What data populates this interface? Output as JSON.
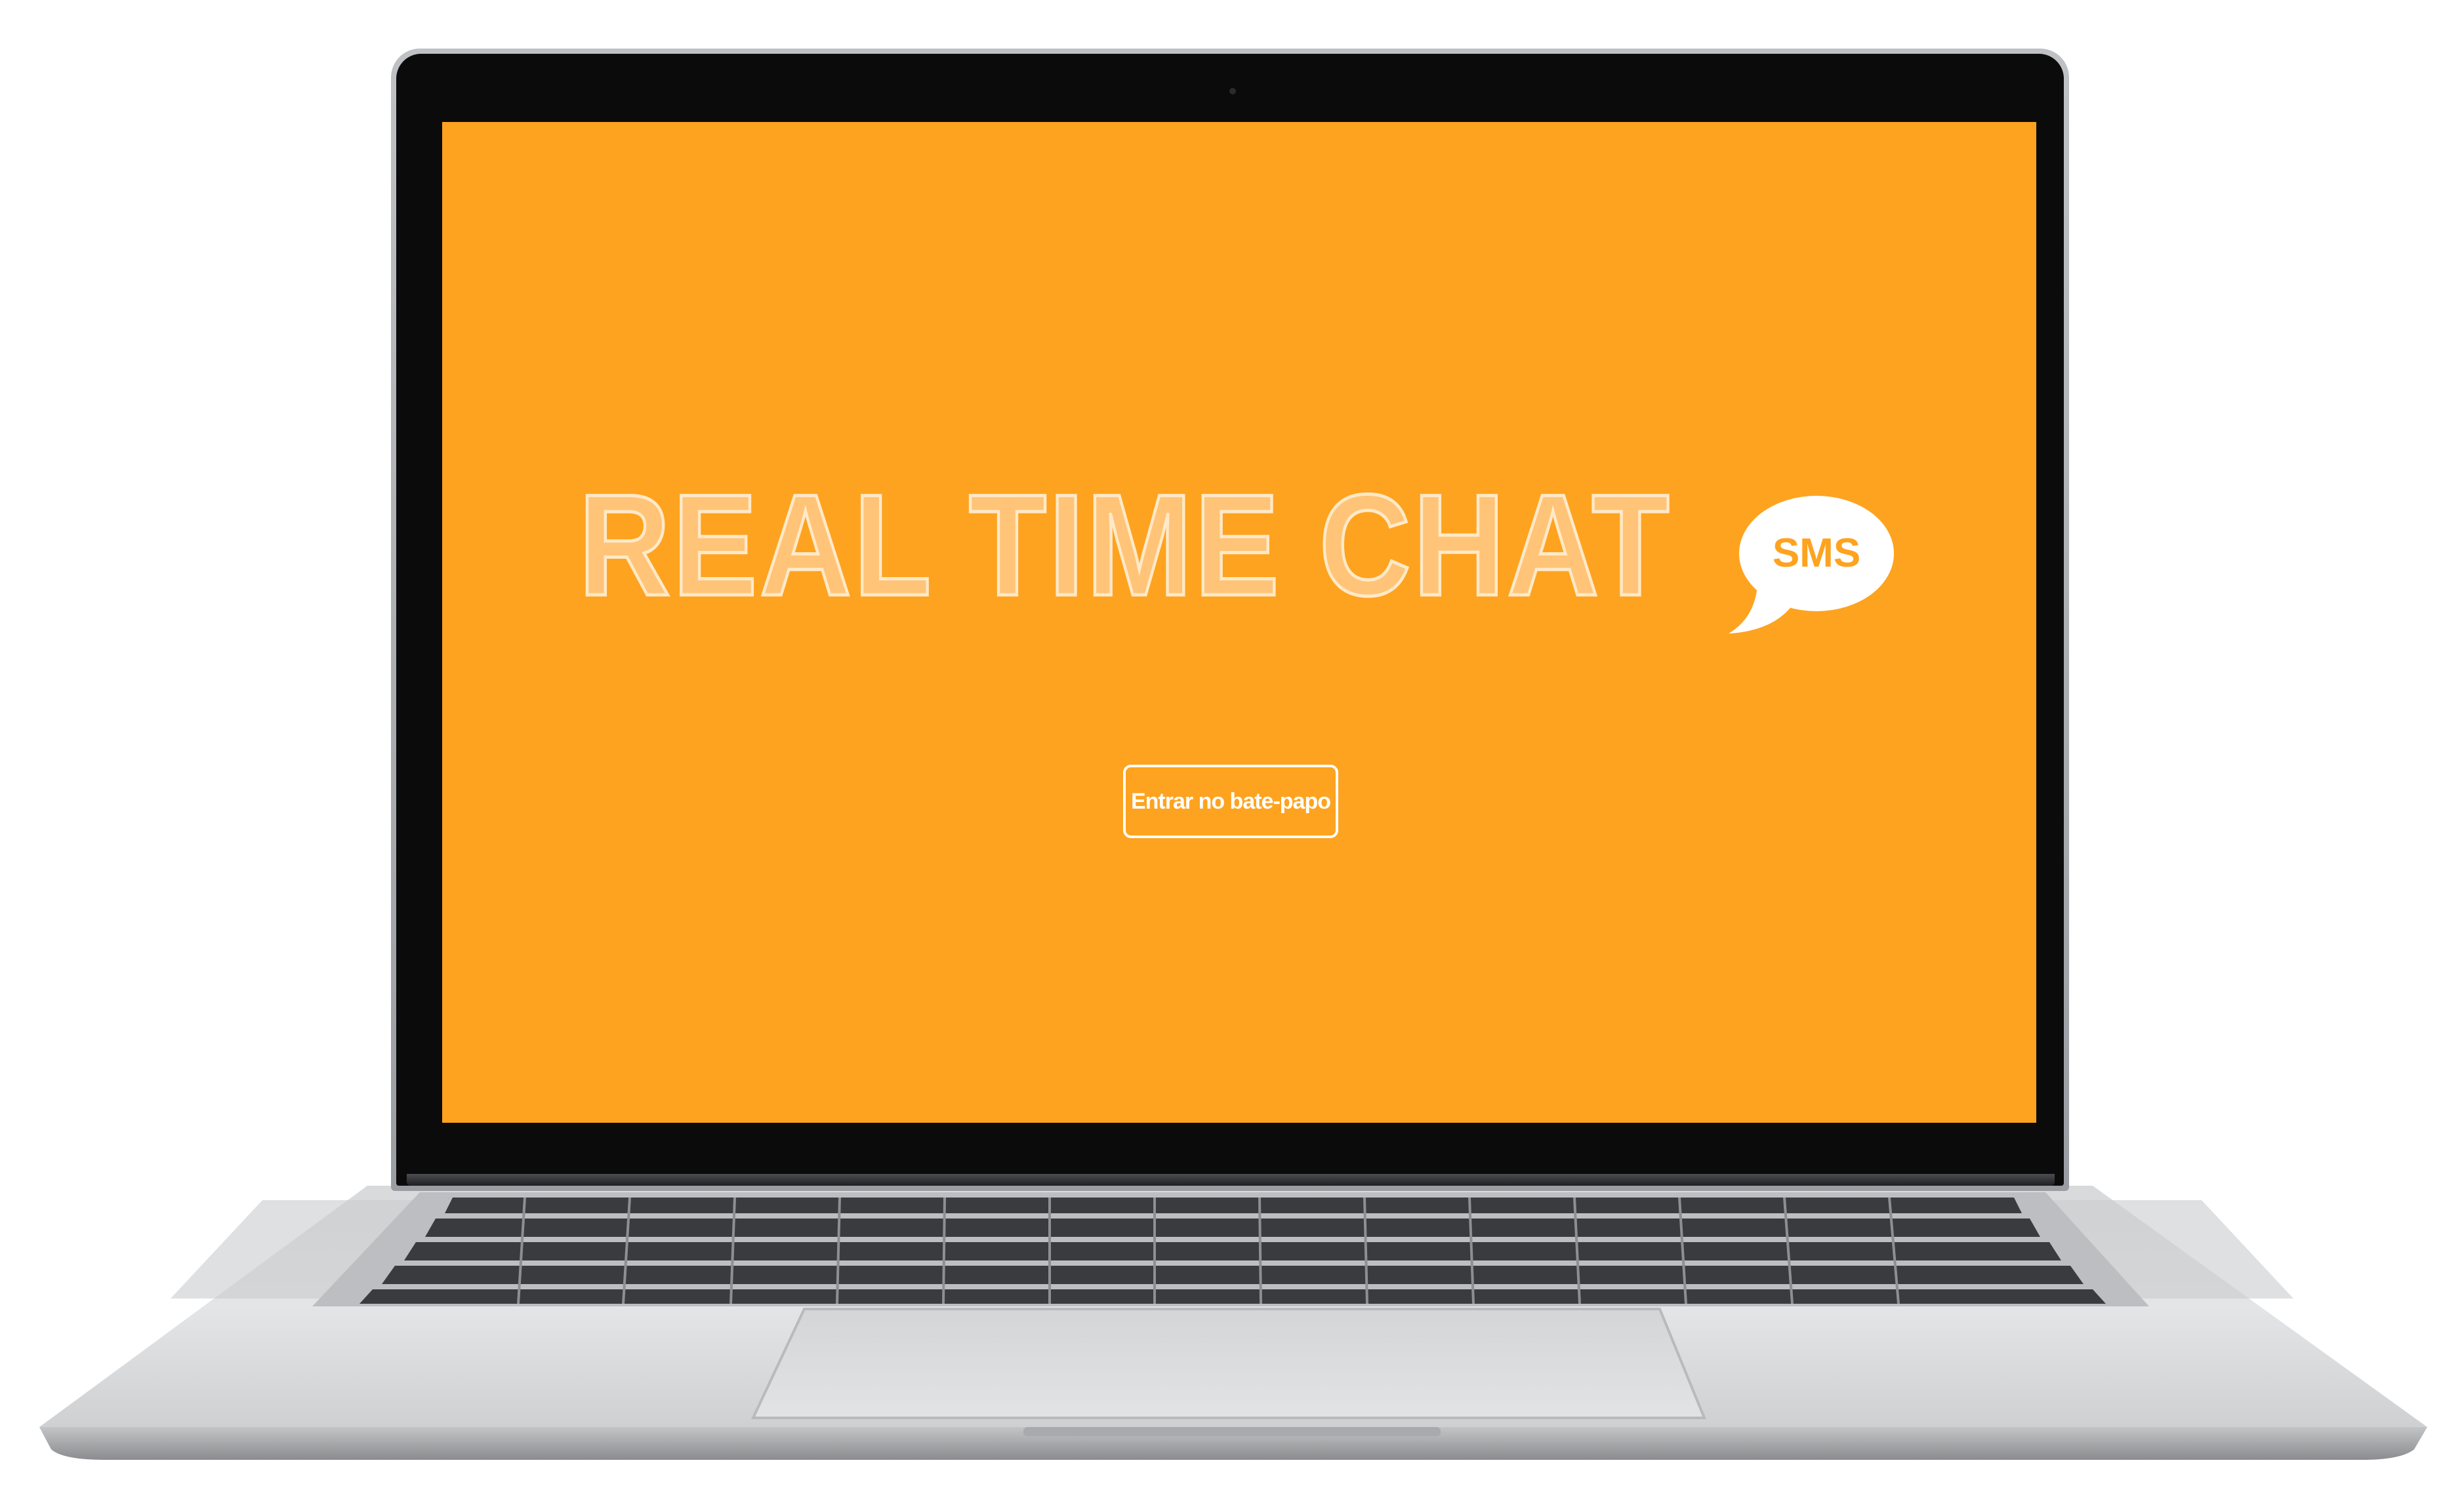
{
  "screen": {
    "title": "REAL TIME CHAT",
    "bubble_text": "SMS",
    "enter_button_label": "Entrar no bate-papo"
  },
  "colors": {
    "background": "#fea31f",
    "title_fill": "#ffc478",
    "title_stroke": "#ffe9c8",
    "button_border": "#ffffff"
  },
  "icons": {
    "bubble": "speech-bubble-icon"
  }
}
